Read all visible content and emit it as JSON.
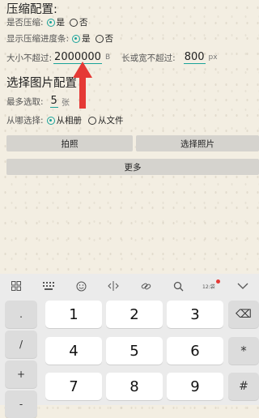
{
  "compress": {
    "title": "压缩配置:",
    "is_compress_label": "是否压缩:",
    "yes": "是",
    "no": "否",
    "show_progress_label": "显示压缩进度条:",
    "max_size_label": "大小不超过:",
    "max_size_value": "2000000",
    "max_size_unit": "B",
    "max_dim_label": "长或宽不超过:",
    "max_dim_value": "800",
    "max_dim_unit": "px"
  },
  "select": {
    "title": "选择图片配置",
    "max_count_label": "最多选取:",
    "max_count_value": "5",
    "max_count_unit": "张",
    "source_label": "从哪选择:",
    "source_album": "从相册",
    "source_file": "从文件",
    "take_photo": "拍照",
    "choose_photo": "选择照片",
    "more": "更多"
  },
  "keyboard": {
    "toolbar_icons": [
      "grid-icon",
      "keyboard-icon",
      "emoji-icon",
      "cursor-move-icon",
      "link-icon",
      "search-icon",
      "clipboard-icon",
      "collapse-icon"
    ],
    "clipboard_badge": "12:袋",
    "side_left": [
      ".",
      "/",
      "+",
      "-"
    ],
    "keys": [
      "1",
      "2",
      "3",
      "4",
      "5",
      "6",
      "7",
      "8",
      "9"
    ],
    "side_right": [
      "⌫",
      "*",
      "#"
    ]
  },
  "colors": {
    "accent": "#1aa39a",
    "arrow": "#e53935"
  }
}
